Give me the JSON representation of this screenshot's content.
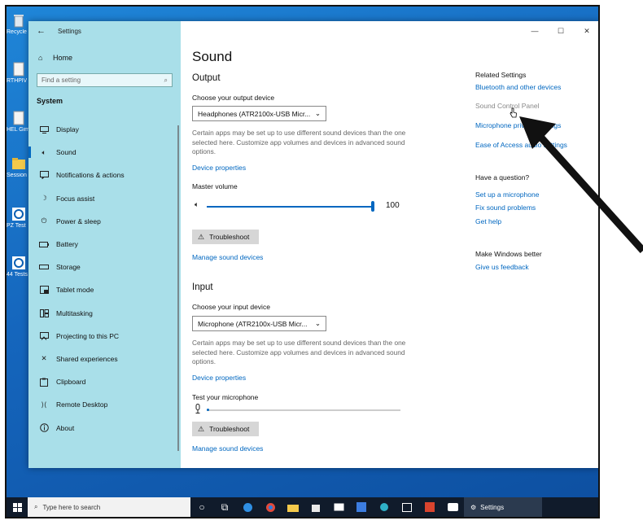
{
  "desktop": {
    "icons": [
      {
        "label": "Recycle",
        "icon": "recycle-bin-icon"
      },
      {
        "label": "RTHPlV",
        "icon": "file-icon"
      },
      {
        "label": "HEL Gimbal",
        "icon": "file-icon"
      },
      {
        "label": "Session",
        "icon": "folder-icon"
      },
      {
        "label": "PZ Test",
        "icon": "app-icon"
      },
      {
        "label": "44 Tests",
        "icon": "app-icon"
      }
    ]
  },
  "taskbar": {
    "search_placeholder": "Type here to search",
    "active_app": "Settings"
  },
  "window": {
    "title": "Settings",
    "controls": {
      "minimize": "—",
      "maximize": "☐",
      "close": "✕"
    }
  },
  "sidebar": {
    "home": "Home",
    "search_placeholder": "Find a setting",
    "section": "System",
    "items": [
      {
        "label": "Display",
        "icon": "display-icon"
      },
      {
        "label": "Sound",
        "icon": "speaker-icon",
        "selected": true
      },
      {
        "label": "Notifications & actions",
        "icon": "notifications-icon"
      },
      {
        "label": "Focus assist",
        "icon": "moon-icon"
      },
      {
        "label": "Power & sleep",
        "icon": "power-icon"
      },
      {
        "label": "Battery",
        "icon": "battery-icon"
      },
      {
        "label": "Storage",
        "icon": "storage-icon"
      },
      {
        "label": "Tablet mode",
        "icon": "tablet-icon"
      },
      {
        "label": "Multitasking",
        "icon": "multitasking-icon"
      },
      {
        "label": "Projecting to this PC",
        "icon": "projecting-icon"
      },
      {
        "label": "Shared experiences",
        "icon": "shared-icon"
      },
      {
        "label": "Clipboard",
        "icon": "clipboard-icon"
      },
      {
        "label": "Remote Desktop",
        "icon": "remote-icon"
      },
      {
        "label": "About",
        "icon": "info-icon"
      }
    ]
  },
  "main": {
    "title": "Sound",
    "output": {
      "heading": "Output",
      "device_label": "Choose your output device",
      "device_value": "Headphones (ATR2100x-USB Micr...",
      "note": "Certain apps may be set up to use different sound devices than the one selected here. Customize app volumes and devices in advanced sound options.",
      "device_properties": "Device properties",
      "volume_label": "Master volume",
      "volume_value": "100",
      "volume_level": 1.0,
      "troubleshoot": "Troubleshoot",
      "manage": "Manage sound devices"
    },
    "input": {
      "heading": "Input",
      "device_label": "Choose your input device",
      "device_value": "Microphone (ATR2100x-USB Micr...",
      "note": "Certain apps may be set up to use different sound devices than the one selected here. Customize app volumes and devices in advanced sound options.",
      "device_properties": "Device properties",
      "test_label": "Test your microphone",
      "mic_level": 0.0,
      "troubleshoot": "Troubleshoot",
      "manage": "Manage sound devices"
    }
  },
  "related": {
    "heading": "Related Settings",
    "links": [
      "Bluetooth and other devices",
      "Sound Control Panel",
      "Microphone privacy settings",
      "Ease of Access audio settings"
    ],
    "question_heading": "Have a question?",
    "question_links": [
      "Set up a microphone",
      "Fix sound problems",
      "Get help"
    ],
    "better_heading": "Make Windows better",
    "feedback": "Give us feedback"
  },
  "colors": {
    "accent": "#0067c0",
    "sidebar": "#a9dfe9",
    "desktop": "#1566bd"
  }
}
